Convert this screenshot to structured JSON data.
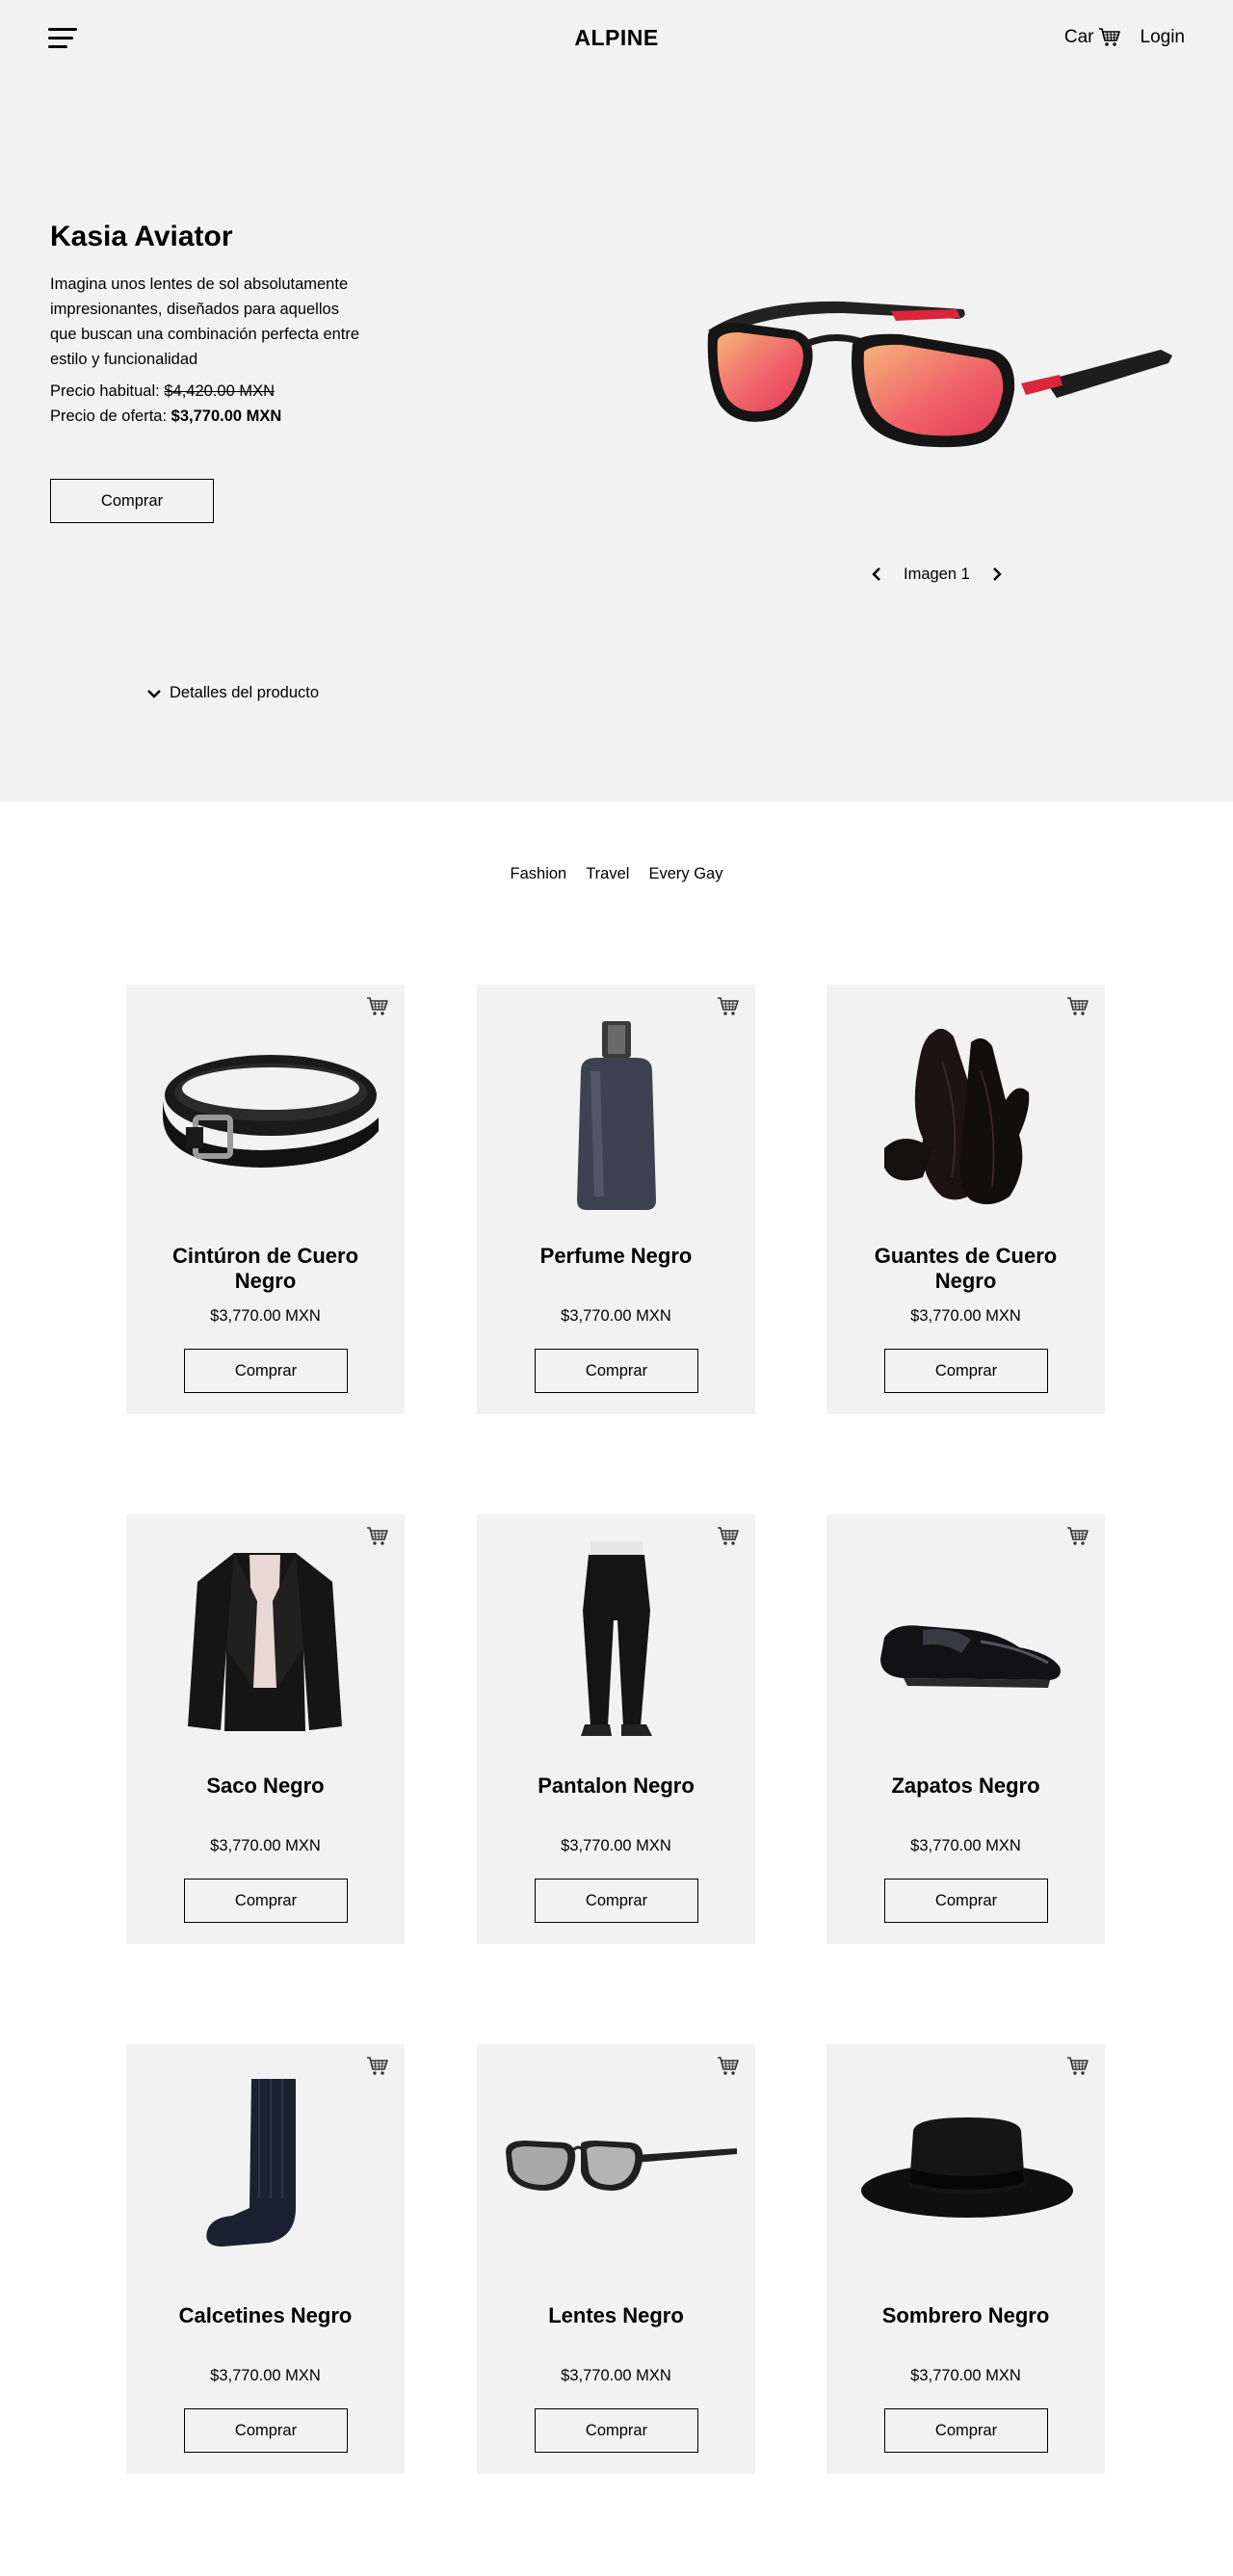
{
  "header": {
    "brand": "ALPINE",
    "cart_label": "Car",
    "login_label": "Login"
  },
  "hero": {
    "title": "Kasia Aviator",
    "description": "Imagina unos lentes de sol absolutamente impresionantes, diseñados para aquellos que buscan una combinación perfecta entre estilo y funcionalidad",
    "regular_label": "Precio habitual:",
    "regular_price": "$4,420.00 MXN",
    "offer_label": "Precio de oferta:",
    "offer_price": "$3,770.00 MXN",
    "buy_label": "Comprar",
    "image_label": "Imagen 1",
    "details_label": "Detalles del producto"
  },
  "tabs": [
    "Fashion",
    "Travel",
    "Every Gay"
  ],
  "products": [
    {
      "name": "Cintúron de Cuero Negro",
      "price": "$3,770.00 MXN",
      "buy": "Comprar",
      "icon": "belt"
    },
    {
      "name": "Perfume Negro",
      "price": "$3,770.00 MXN",
      "buy": "Comprar",
      "icon": "perfume"
    },
    {
      "name": "Guantes de Cuero Negro",
      "price": "$3,770.00 MXN",
      "buy": "Comprar",
      "icon": "gloves"
    },
    {
      "name": "Saco Negro",
      "price": "$3,770.00 MXN",
      "buy": "Comprar",
      "icon": "blazer"
    },
    {
      "name": "Pantalon Negro",
      "price": "$3,770.00 MXN",
      "buy": "Comprar",
      "icon": "pants"
    },
    {
      "name": "Zapatos Negro",
      "price": "$3,770.00 MXN",
      "buy": "Comprar",
      "icon": "shoe"
    },
    {
      "name": "Calcetines Negro",
      "price": "$3,770.00 MXN",
      "buy": "Comprar",
      "icon": "sock"
    },
    {
      "name": "Lentes Negro",
      "price": "$3,770.00 MXN",
      "buy": "Comprar",
      "icon": "sunglasses"
    },
    {
      "name": "Sombrero Negro",
      "price": "$3,770.00 MXN",
      "buy": "Comprar",
      "icon": "hat"
    }
  ]
}
